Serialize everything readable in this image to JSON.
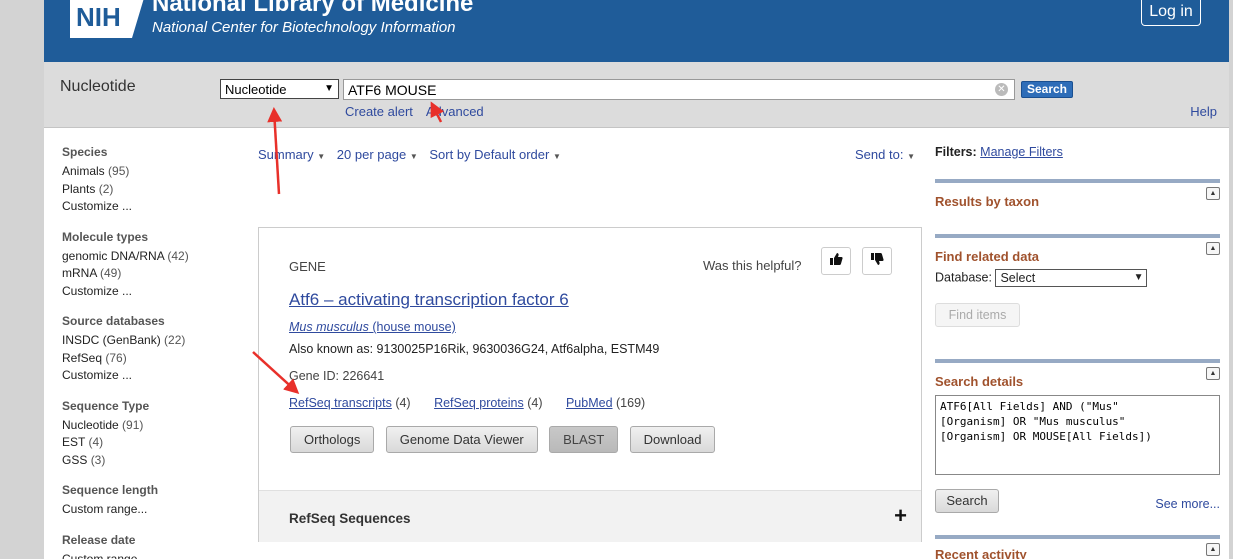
{
  "header": {
    "logo_text": "NIH",
    "title": "National Library of Medicine",
    "subtitle": "National Center for Biotechnology Information",
    "login_label": "Log in"
  },
  "searchbar": {
    "db_title": "Nucleotide",
    "db_selected": "Nucleotide",
    "query": "ATF6 MOUSE",
    "search_label": "Search",
    "create_alert": "Create alert",
    "advanced": "Advanced",
    "help": "Help"
  },
  "sidebar": {
    "facets": [
      {
        "title": "Species",
        "items": [
          {
            "label": "Animals",
            "count": "(95)"
          },
          {
            "label": "Plants",
            "count": "(2)"
          },
          {
            "label": "Customize ...",
            "count": ""
          }
        ]
      },
      {
        "title": "Molecule types",
        "items": [
          {
            "label": "genomic DNA/RNA",
            "count": "(42)"
          },
          {
            "label": "mRNA",
            "count": "(49)"
          },
          {
            "label": "Customize ...",
            "count": ""
          }
        ]
      },
      {
        "title": "Source databases",
        "items": [
          {
            "label": "INSDC (GenBank)",
            "count": "(22)"
          },
          {
            "label": "RefSeq",
            "count": "(76)"
          },
          {
            "label": "Customize ...",
            "count": ""
          }
        ]
      },
      {
        "title": "Sequence Type",
        "items": [
          {
            "label": "Nucleotide",
            "count": "(91)"
          },
          {
            "label": "EST",
            "count": "(4)"
          },
          {
            "label": "GSS",
            "count": "(3)"
          }
        ]
      },
      {
        "title": "Sequence length",
        "items": [
          {
            "label": "Custom range...",
            "count": ""
          }
        ]
      },
      {
        "title": "Release date",
        "items": [
          {
            "label": "Custom range...",
            "count": ""
          }
        ]
      }
    ]
  },
  "toolbar": {
    "summary": "Summary",
    "per_page": "20 per page",
    "sort": "Sort by Default order",
    "send_to": "Send to:"
  },
  "card": {
    "category": "GENE",
    "helpful": "Was this helpful?",
    "gene_title": "Atf6  –  activating transcription factor 6",
    "organism_latin": "Mus musculus",
    "organism_common": " (house mouse)",
    "aka": "Also known as: 9130025P16Rik, 9630036G24, Atf6alpha, ESTM49",
    "gene_id": "Gene ID: 226641",
    "links": [
      {
        "label": "RefSeq transcripts",
        "count": "(4)"
      },
      {
        "label": "RefSeq proteins",
        "count": "(4)"
      },
      {
        "label": "PubMed",
        "count": "(169)"
      }
    ],
    "buttons": [
      "Orthologs",
      "Genome Data Viewer",
      "BLAST",
      "Download"
    ],
    "refseq_section": "RefSeq Sequences"
  },
  "right": {
    "filters_label": "Filters:",
    "manage_filters": "Manage Filters",
    "results_by_taxon": "Results by taxon",
    "find_related": "Find related data",
    "database_label": "Database:",
    "database_selected": "Select",
    "find_items": "Find items",
    "search_details": "Search details",
    "search_details_text": "ATF6[All Fields] AND (\"Mus\"\n[Organism] OR \"Mus musculus\"\n[Organism] OR MOUSE[All Fields])",
    "search_button": "Search",
    "see_more": "See more...",
    "recent_activity": "Recent activity"
  },
  "colors": {
    "header_bg": "#1f5c99",
    "link": "#2f4a9e",
    "section_title": "#a0522d",
    "annotation": "#e8302a"
  }
}
